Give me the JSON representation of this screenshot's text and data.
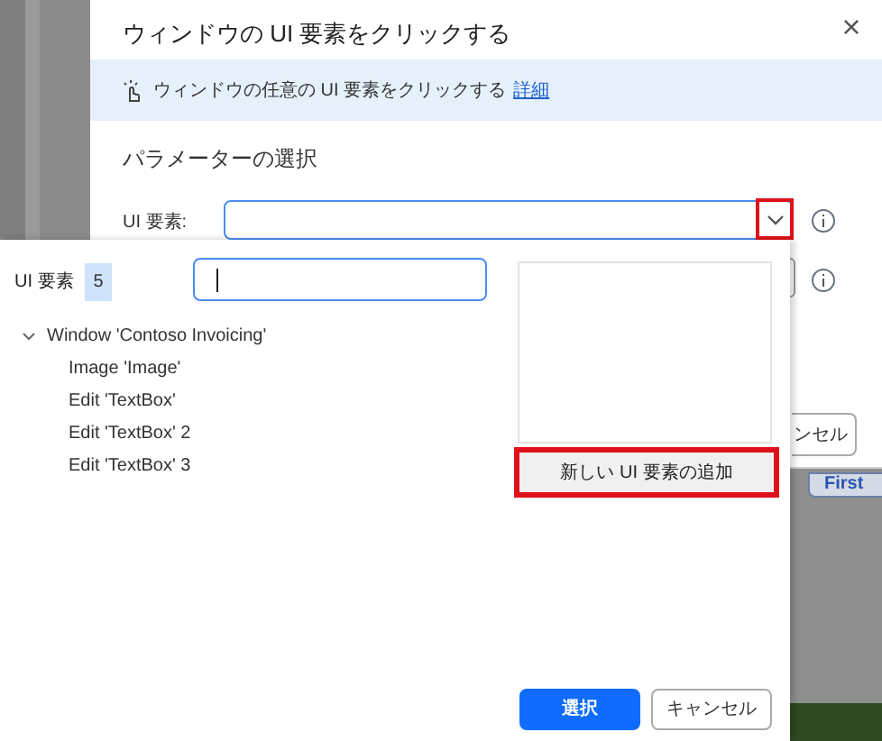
{
  "back_dialog": {
    "title": "ウィンドウの UI 要素をクリックする",
    "close_glyph": "×",
    "info_bar": {
      "text": "ウィンドウの任意の UI 要素をクリックする",
      "link": "詳細"
    },
    "section_heading": "パラメーターの選択",
    "ui_element_field": {
      "label": "UI 要素:",
      "dropdown_highlighted": true
    },
    "cancel_fragment": "ンセル"
  },
  "background_app": {
    "tab_fragment": "First"
  },
  "picker_panel": {
    "label": "UI 要素",
    "count": "5",
    "tree": [
      {
        "label": "Window 'Contoso Invoicing'",
        "expanded": true,
        "children": [
          {
            "label": "Image 'Image'"
          },
          {
            "label": "Edit 'TextBox'"
          },
          {
            "label": "Edit 'TextBox' 2"
          },
          {
            "label": "Edit 'TextBox' 3"
          }
        ]
      }
    ],
    "add_button": {
      "label": "新しい UI 要素の追加",
      "highlighted": true
    },
    "buttons": [
      {
        "label": "選択",
        "kind": "primary"
      },
      {
        "label": "キャンセル",
        "kind": "secondary"
      }
    ]
  }
}
